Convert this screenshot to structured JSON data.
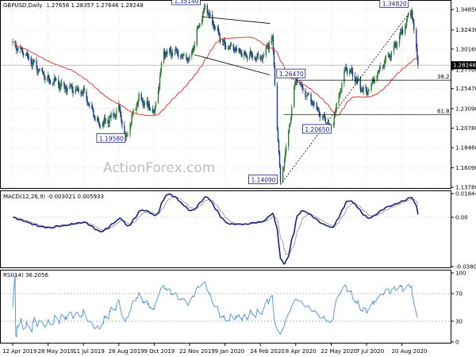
{
  "main": {
    "title": "GBPUSD,Daily",
    "ohlc": "1.27656 1.28357 1.27646 1.28248",
    "watermark": "ActionForex.com",
    "last_price": "1.28248",
    "price_ticks": [
      "1.34850",
      "1.32430",
      "1.30160",
      "1.27700",
      "1.25470",
      "1.23090",
      "1.20780",
      "1.18460",
      "1.16090",
      "1.13780"
    ],
    "fib_38_label": "38.2",
    "fib_61_label": "61.8",
    "annotations": [
      "1.35140",
      "1.34820",
      "1.26470",
      "1.20650",
      "1.19580",
      "1.14090"
    ]
  },
  "macd": {
    "title": "MACD(12,26,9) -0.003021 0.005933",
    "ticks": [
      "0.018442",
      "0.00",
      "-0.038095"
    ]
  },
  "rsi": {
    "title": "RSI(14) 36.2056",
    "ticks": [
      "100",
      "70",
      "30",
      "0"
    ]
  },
  "x_labels": [
    "12 Apr 2019",
    "28 May 2019",
    "11 Jul 2019",
    "26 Aug 2019",
    "9 Oct 2019",
    "22 Nov 2019",
    "9 Jan 2020",
    "24 Feb 2020",
    "8 Apr 2020",
    "22 May 2020",
    "7 Jul 2020",
    "20 Aug 2020"
  ],
  "colors": {
    "up_candle": "#2e7d32",
    "down_candle": "#1b3a8a",
    "ma": "#e53935",
    "macd_line": "#1a237e",
    "signal_line": "#a0a0a0",
    "rsi_line": "#4a90d9",
    "trend": "#000000"
  },
  "chart_data": {
    "type": "candlestick",
    "series_anchors_price": [
      [
        "12 Apr 2019",
        1.31
      ],
      [
        "28 May 2019",
        1.265
      ],
      [
        "11 Jul 2019",
        1.25
      ],
      [
        "1 Aug 2019",
        1.21
      ],
      [
        "26 Aug 2019",
        1.23
      ],
      [
        "3 Sep 2019",
        1.1958
      ],
      [
        "20 Sep 2019",
        1.245
      ],
      [
        "9 Oct 2019",
        1.225
      ],
      [
        "21 Oct 2019",
        1.3
      ],
      [
        "22 Nov 2019",
        1.29
      ],
      [
        "13 Dec 2019",
        1.3514
      ],
      [
        "9 Jan 2020",
        1.305
      ],
      [
        "24 Feb 2020",
        1.29
      ],
      [
        "10 Mar 2020",
        1.315
      ],
      [
        "20 Mar 2020",
        1.1409
      ],
      [
        "8 Apr 2020",
        1.2647
      ],
      [
        "22 May 2020",
        1.2065
      ],
      [
        "10 Jun 2020",
        1.28
      ],
      [
        "7 Jul 2020",
        1.25
      ],
      [
        "20 Aug 2020",
        1.32
      ],
      [
        "1 Sep 2020",
        1.3482
      ],
      [
        "9 Sep 2020",
        1.2825
      ]
    ],
    "moving_average": "red line",
    "macd": {
      "signal": 0.005933,
      "macd": -0.003021,
      "ylim": [
        -0.038095,
        0.018442
      ]
    },
    "rsi": {
      "last": 36.2056,
      "levels": [
        70,
        30
      ],
      "ylim": [
        0,
        100
      ]
    },
    "ylim": [
      1.1378,
      1.3485
    ]
  }
}
